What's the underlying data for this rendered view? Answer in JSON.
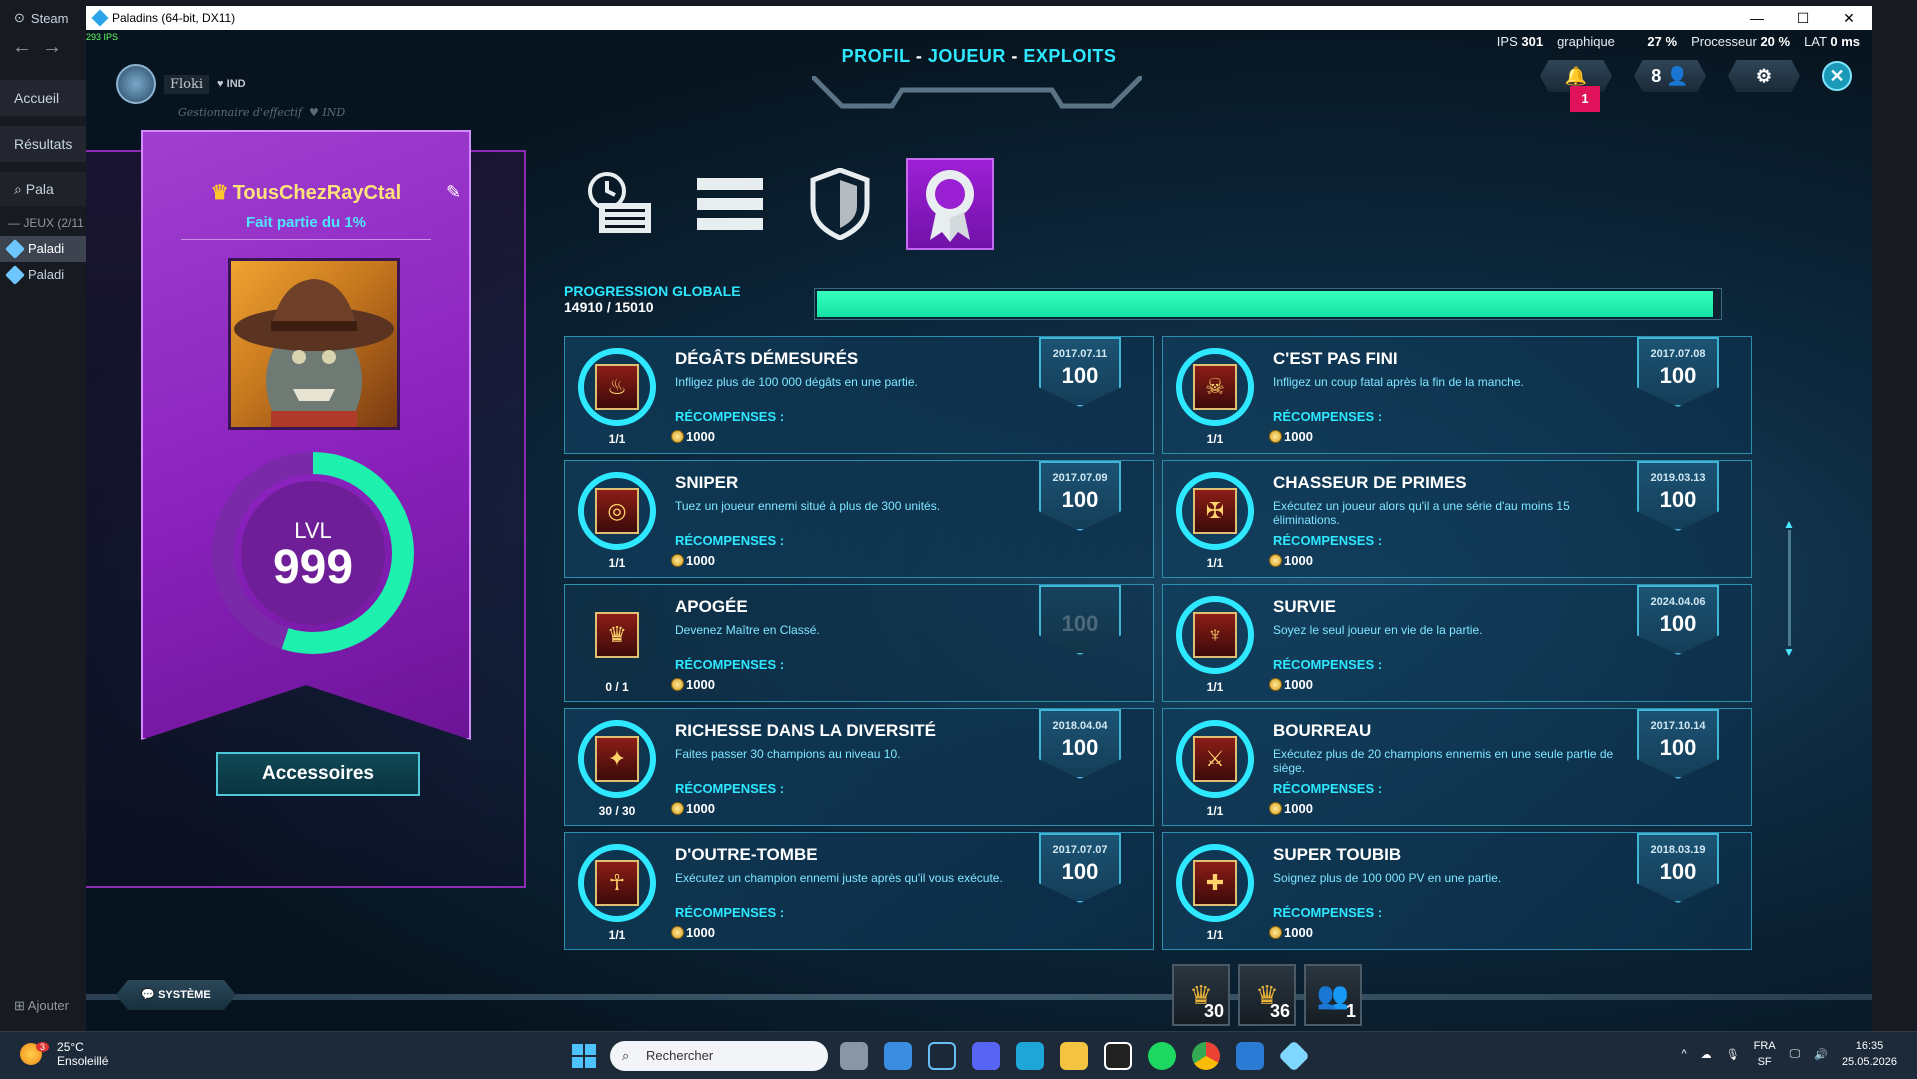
{
  "steam": {
    "brand": "Steam",
    "nav_back": "←",
    "nav_forward": "→",
    "home": "Accueil",
    "results": "Résultats",
    "search_value": "Pala",
    "games_header": "— JEUX (2/11",
    "games": [
      "Paladi",
      "Paladi"
    ],
    "add": "Ajouter"
  },
  "window": {
    "title": "Paladins (64-bit, DX11)",
    "min": "—",
    "max": "☐",
    "close": "✕"
  },
  "hud": {
    "ips_small": "293 IPS",
    "ips_label": "IPS",
    "ips_value": "301",
    "gfx_label": "graphique",
    "gfx_value": "27 %",
    "cpu_label": "Processeur",
    "cpu_value": "20 %",
    "lat_label": "LAT",
    "lat_value": "0 ms",
    "notifications": "1",
    "party_count": "8",
    "player_name": "Floki",
    "player_tag": "IND",
    "player_sub": "Gestionnaire d'effectif",
    "player_sub_tag": "IND"
  },
  "title": {
    "part1": "PROFIL",
    "sep": " - ",
    "part2": "JOUEUR",
    "part3": "EXPLOITS"
  },
  "profile": {
    "name": "TousChezRayCtal",
    "subtitle": "Fait partie du 1%",
    "lvl_label": "LVL",
    "lvl_value": "999",
    "level_ring_fraction": 0.55,
    "accessories": "Accessoires"
  },
  "tabs": [
    {
      "name": "stats",
      "active": false
    },
    {
      "name": "list",
      "active": false
    },
    {
      "name": "shield",
      "active": false
    },
    {
      "name": "achievements",
      "active": true
    }
  ],
  "progress": {
    "label": "PROGRESSION GLOBALE",
    "value": "14910 / 15010",
    "fraction": 0.9933
  },
  "rewards_label": "RÉCOMPENSES :",
  "achievements": [
    {
      "title": "DÉGÂTS DÉMESURÉS",
      "desc": "Infligez plus de 100 000 dégâts en une partie.",
      "count": "1/1",
      "reward": "1000",
      "date": "2017.07.11",
      "points": "100",
      "done": true
    },
    {
      "title": "C'EST PAS FINI",
      "desc": "Infligez un coup fatal après la fin de la manche.",
      "count": "1/1",
      "reward": "1000",
      "date": "2017.07.08",
      "points": "100",
      "done": true
    },
    {
      "title": "SNIPER",
      "desc": "Tuez un joueur ennemi situé à plus de 300 unités.",
      "count": "1/1",
      "reward": "1000",
      "date": "2017.07.09",
      "points": "100",
      "done": true
    },
    {
      "title": "CHASSEUR DE PRIMES",
      "desc": "Exécutez un joueur alors qu'il a une série d'au moins 15 éliminations.",
      "count": "1/1",
      "reward": "1000",
      "date": "2019.03.13",
      "points": "100",
      "done": true
    },
    {
      "title": "APOGÉE",
      "desc": "Devenez Maître en Classé.",
      "count": "0 / 1",
      "reward": "1000",
      "date": "",
      "points": "100",
      "done": false
    },
    {
      "title": "SURVIE",
      "desc": "Soyez le seul joueur en vie de la partie.",
      "count": "1/1",
      "reward": "1000",
      "date": "2024.04.06",
      "points": "100",
      "done": true
    },
    {
      "title": "RICHESSE DANS LA DIVERSITÉ",
      "desc": "Faites passer 30 champions au niveau 10.",
      "count": "30 / 30",
      "reward": "1000",
      "date": "2018.04.04",
      "points": "100",
      "done": true
    },
    {
      "title": "BOURREAU",
      "desc": "Exécutez plus de 20 champions ennemis en une seule partie de siège.",
      "count": "1/1",
      "reward": "1000",
      "date": "2017.10.14",
      "points": "100",
      "done": true
    },
    {
      "title": "D'OUTRE-TOMBE",
      "desc": "Exécutez un champion ennemi juste après qu'il vous exécute.",
      "count": "1/1",
      "reward": "1000",
      "date": "2017.07.07",
      "points": "100",
      "done": true
    },
    {
      "title": "SUPER TOUBIB",
      "desc": "Soignez plus de 100 000 PV en une partie.",
      "count": "1/1",
      "reward": "1000",
      "date": "2018.03.19",
      "points": "100",
      "done": true
    }
  ],
  "bottom": {
    "system": "SYSTÈME",
    "ranks": [
      "30",
      "36",
      "1"
    ]
  },
  "taskbar": {
    "temp": "25°C",
    "weather": "Ensoleillé",
    "weather_badge": "3",
    "search_placeholder": "Rechercher",
    "lang": "FRA",
    "lang_sub": "SF",
    "time": "16:35",
    "date": "25.05.2026"
  },
  "colors": {
    "accent_cyan": "#2ee8ff",
    "progress_green": "#1ef0ad",
    "banner_purple": "#9a2fd0"
  }
}
